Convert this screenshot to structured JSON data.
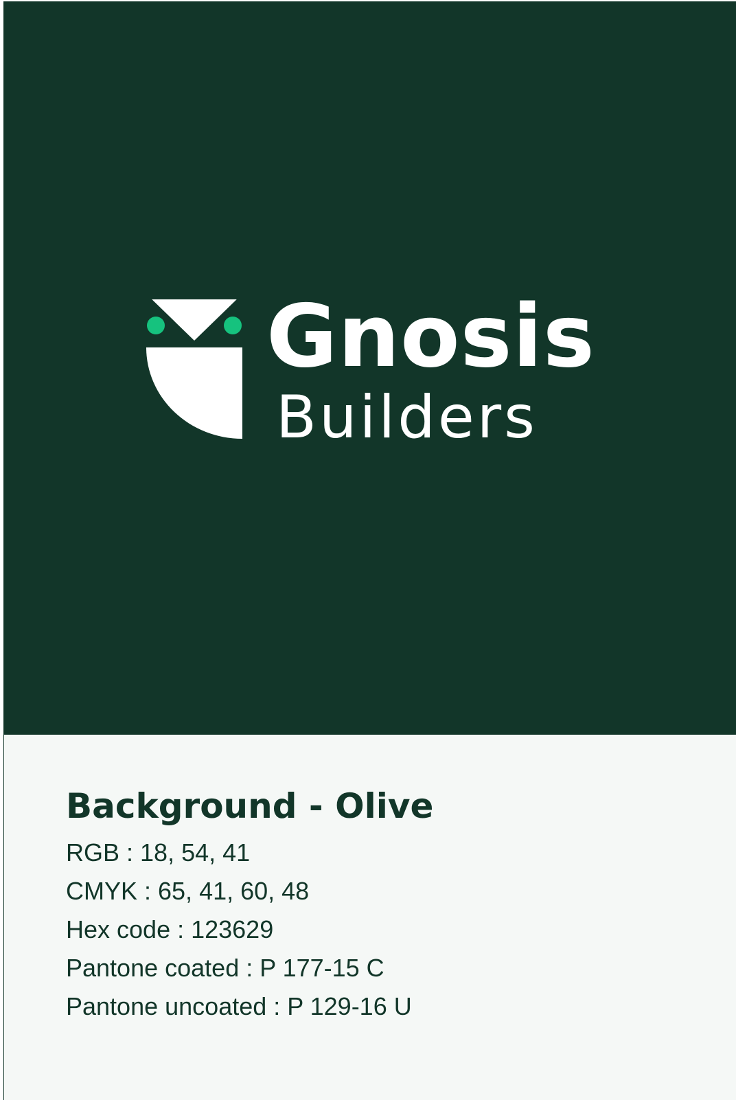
{
  "logo": {
    "word_main": "Gnosis",
    "word_sub": "Builders",
    "icon": "owl-logo-icon",
    "colors": {
      "mark": "#ffffff",
      "eyes": "#16c27e"
    }
  },
  "swatch": {
    "color": "#123629"
  },
  "info": {
    "title": "Background - Olive",
    "rgb": "RGB : 18, 54, 41",
    "cmyk": "CMYK : 65, 41, 60, 48",
    "hex": "Hex code : 123629",
    "pantone_coated": "Pantone coated : P 177-15 C",
    "pantone_uncoated": "Pantone uncoated : P 129-16 U"
  }
}
